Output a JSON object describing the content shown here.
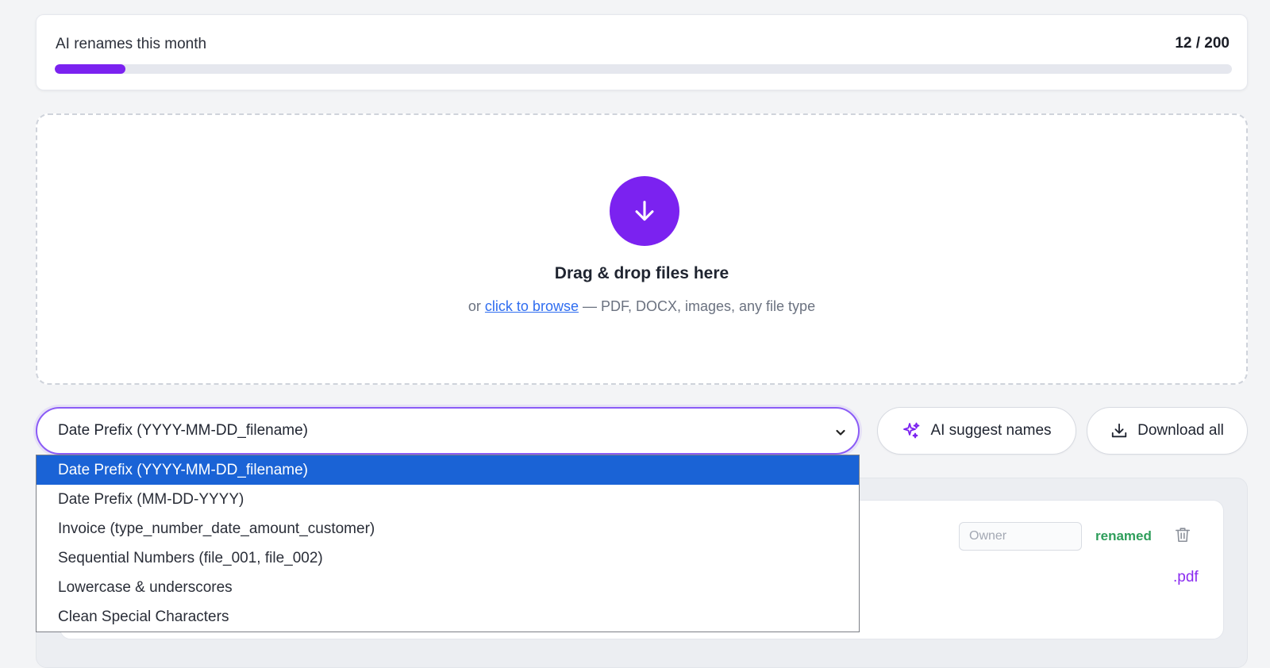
{
  "usage": {
    "label": "AI renames this month",
    "count_text": "12 / 200",
    "used": 12,
    "limit": 200,
    "accent": "#7b22f0"
  },
  "dropzone": {
    "icon": "arrow-down-icon",
    "title": "Drag & drop files here",
    "sub_prefix": "or",
    "browse_link": "click to browse",
    "sub_suffix": "— PDF, DOCX, images, any file type"
  },
  "template_select": {
    "value": "Date Prefix (YYYY-MM-DD_filename)",
    "options": [
      "Date Prefix (YYYY-MM-DD_filename)",
      "Date Prefix (MM-DD-YYYY)",
      "Invoice (type_number_date_amount_customer)",
      "Sequential Numbers (file_001, file_002)",
      "Lowercase & underscores",
      "Clean Special Characters"
    ],
    "selected_index": 0,
    "highlight_color": "#1a63d6"
  },
  "actions": {
    "ai_suggest_label": "AI suggest names",
    "ai_suggest_icon": "sparkles-icon",
    "download_all_label": "Download all",
    "download_icon": "download-icon"
  },
  "file_row": {
    "owner_placeholder": "Owner",
    "status": "renamed",
    "status_color": "#2e9e5b",
    "extension": ".pdf",
    "delete_icon": "trash-icon"
  }
}
